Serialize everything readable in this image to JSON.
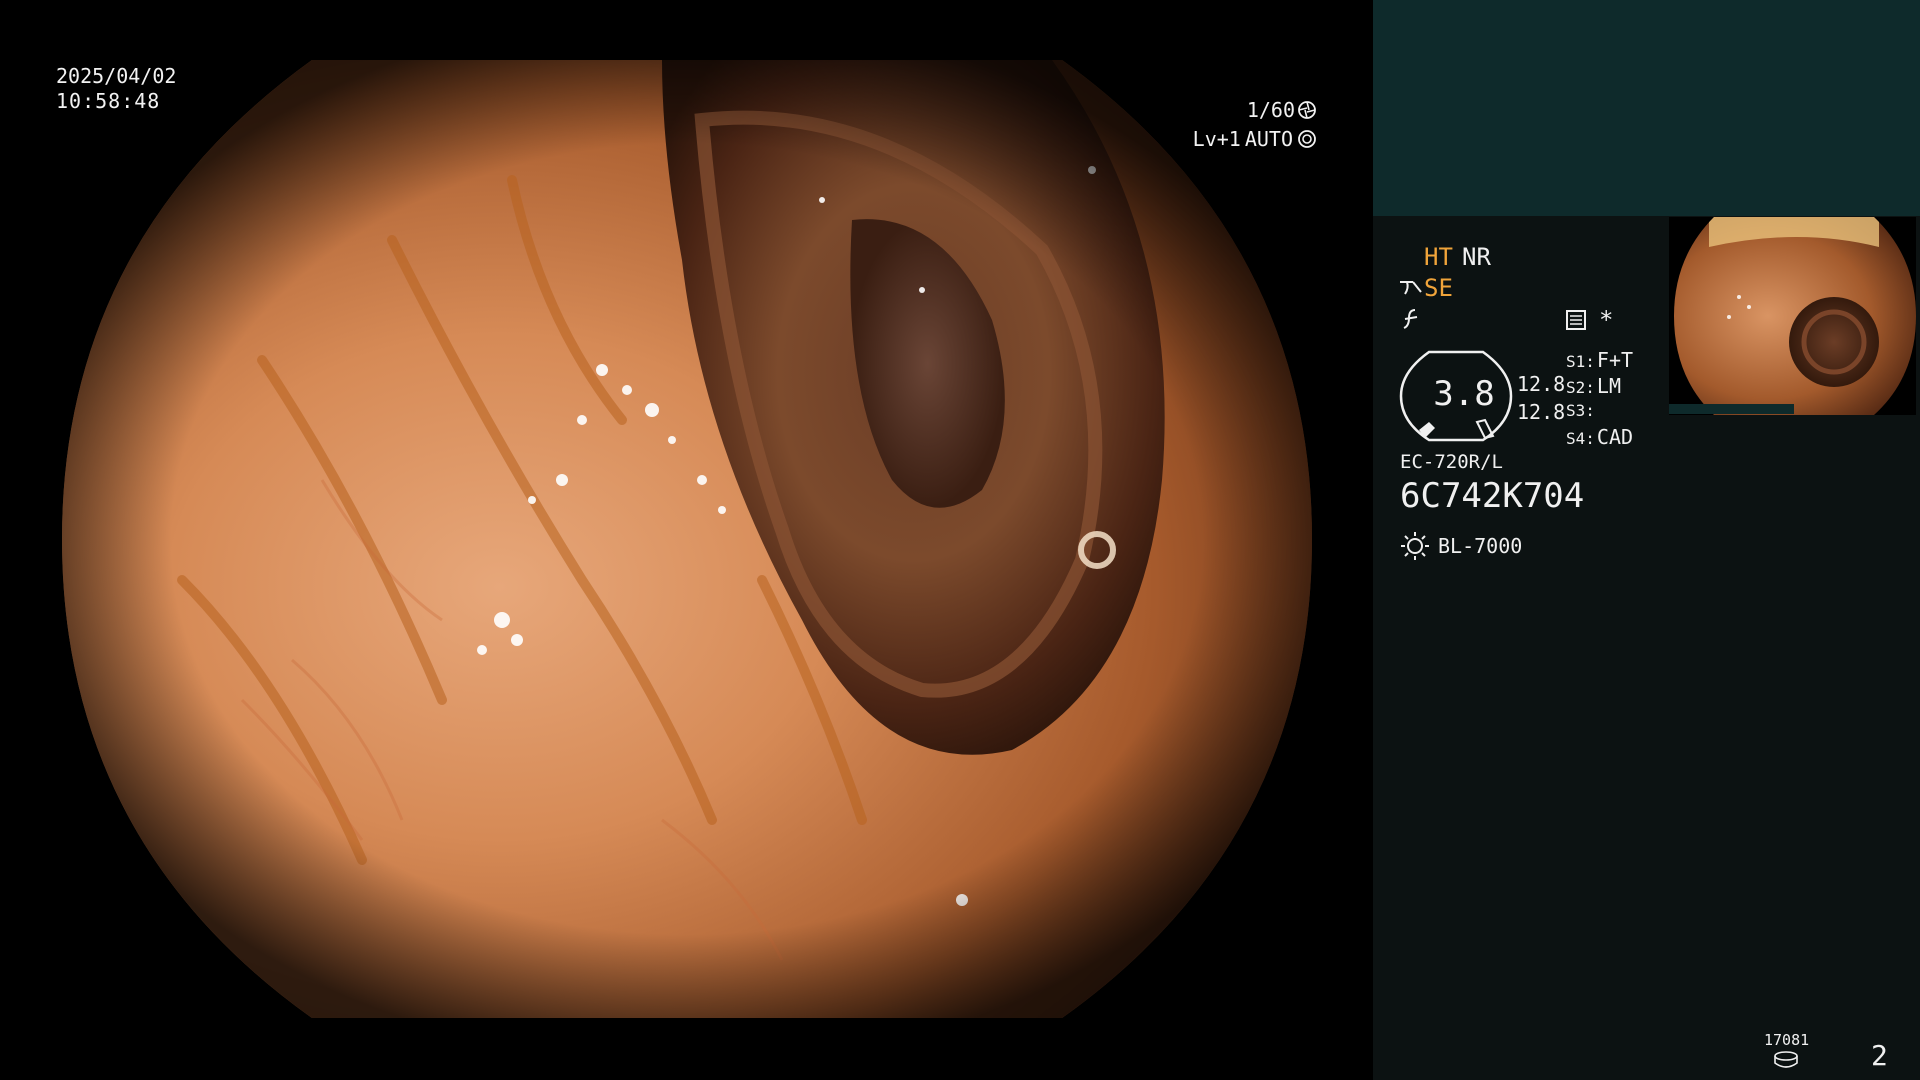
{
  "overlay": {
    "date": "2025/04/02",
    "time": "10:58:48",
    "shutter_speed": "1/60",
    "light_level": "Lv+1",
    "iris_mode": "AUTO"
  },
  "panel": {
    "ht_label": "HT",
    "nr_label": "NR",
    "se_label": "SE",
    "zoom_value": "3.8",
    "brightness_1": "12.8",
    "brightness_2": "12.8",
    "switches": [
      {
        "key": "S1:",
        "value": "F+T"
      },
      {
        "key": "S2:",
        "value": "LM"
      },
      {
        "key": "S3:",
        "value": ""
      },
      {
        "key": "S4:",
        "value": "CAD"
      }
    ],
    "star": "*",
    "scope_model": "EC-720R/L",
    "scope_serial": "6C742K704",
    "light_source": "BL-7000",
    "image_count": "17081",
    "page_number": "2"
  },
  "colors": {
    "panel_background": "#0c1212",
    "panel_top_band": "#0e2a2b",
    "accent_orange": "#f0a43a",
    "text": "#f0f0f0"
  },
  "icons": {
    "shutter": "aperture-icon",
    "iris": "iris-icon",
    "enhance": "structure-enhance-icon",
    "frequency": "frequency-icon",
    "memo": "memo-icon",
    "light": "sun-icon",
    "disk": "disk-icon"
  }
}
